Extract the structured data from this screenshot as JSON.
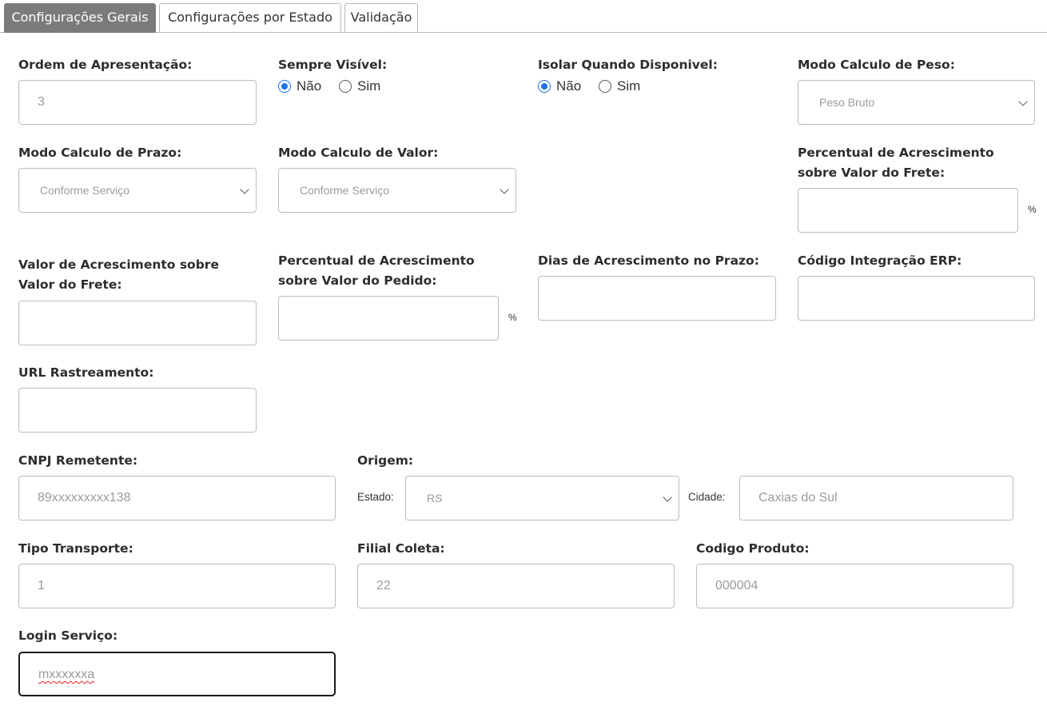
{
  "tabs": [
    {
      "label": "Configurações Gerais",
      "active": true
    },
    {
      "label": "Configurações por Estado",
      "active": false
    },
    {
      "label": "Validação",
      "active": false
    }
  ],
  "ordem_apresentacao": {
    "label": "Ordem de Apresentação:",
    "value": "3"
  },
  "sempre_visivel": {
    "label": "Sempre Visível:",
    "options": [
      "Não",
      "Sim"
    ],
    "selected": "Não"
  },
  "isolar_quando_disponivel": {
    "label": "Isolar Quando Disponivel:",
    "options": [
      "Não",
      "Sim"
    ],
    "selected": "Não"
  },
  "modo_calculo_peso": {
    "label": "Modo Calculo de Peso:",
    "value": "Peso Bruto"
  },
  "modo_calculo_prazo": {
    "label": "Modo Calculo de Prazo:",
    "value": "Conforme Serviço"
  },
  "modo_calculo_valor": {
    "label": "Modo Calculo de Valor:",
    "value": "Conforme Serviço"
  },
  "percentual_acrescimento_frete": {
    "label_line1": "Percentual de Acrescimento",
    "label_line2": "sobre Valor do Frete:",
    "value": "",
    "suffix": "%"
  },
  "valor_acrescimento_frete": {
    "label_line1": "Valor de Acrescimento sobre",
    "label_line2": "Valor do Frete:",
    "value": ""
  },
  "percentual_acrescimento_pedido": {
    "label_line1": "Percentual de Acrescimento",
    "label_line2": "sobre Valor do Pedido:",
    "value": "",
    "suffix": "%"
  },
  "dias_acrescimento_prazo": {
    "label": "Dias de Acrescimento no Prazo:",
    "value": ""
  },
  "codigo_integracao_erp": {
    "label": "Código Integração ERP:",
    "value": ""
  },
  "url_rastreamento": {
    "label": "URL Rastreamento:",
    "value": ""
  },
  "cnpj_remetente": {
    "label": "CNPJ Remetente:",
    "value": "89xxxxxxxxx138"
  },
  "origem": {
    "label": "Origem:",
    "estado_label": "Estado:",
    "estado_value": "RS",
    "cidade_label": "Cidade:",
    "cidade_value": "Caxias do Sul"
  },
  "tipo_transporte": {
    "label": "Tipo Transporte:",
    "value": "1"
  },
  "filial_coleta": {
    "label": "Filial Coleta:",
    "value": "22"
  },
  "codigo_produto": {
    "label": "Codigo Produto:",
    "value": "000004"
  },
  "login_servico": {
    "label": "Login Serviço:",
    "value": "mxxxxxxa"
  },
  "colors": {
    "accent_radio": "#1a73e8",
    "active_tab_bg": "#7b7b7b",
    "input_border": "#bdbdbd"
  }
}
